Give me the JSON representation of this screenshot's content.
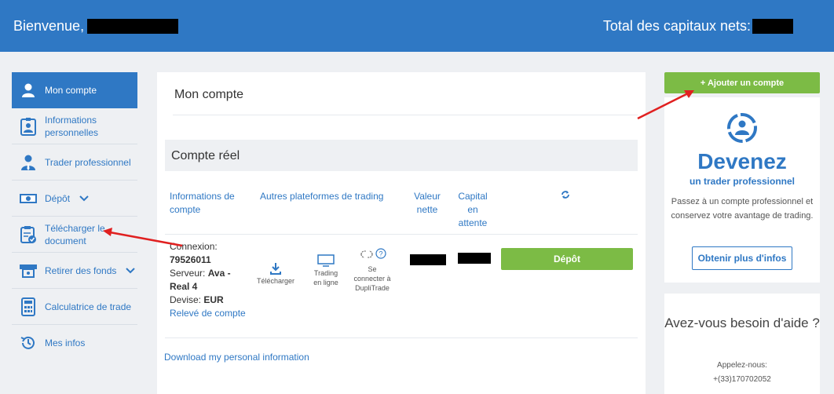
{
  "header": {
    "welcome": "Bienvenue,",
    "total_label": "Total des capitaux nets:"
  },
  "sidebar": {
    "items": [
      {
        "label": "Mon compte",
        "icon": "user-icon",
        "active": true
      },
      {
        "label": "Informations personnelles",
        "icon": "id-card-icon"
      },
      {
        "label": "Trader professionnel",
        "icon": "trader-icon"
      },
      {
        "label": "Dépôt",
        "icon": "cash-icon",
        "chevron": true
      },
      {
        "label": "Télécharger le document",
        "icon": "clipboard-check-icon"
      },
      {
        "label": "Retirer des fonds",
        "icon": "withdraw-icon",
        "chevron": true
      },
      {
        "label": "Calculatrice de trade",
        "icon": "calculator-icon"
      },
      {
        "label": "Mes infos",
        "icon": "history-icon"
      }
    ]
  },
  "main": {
    "title": "Mon compte",
    "section_title": "Compte réel",
    "columns": {
      "account_info": "Informations de compte",
      "platforms": "Autres plateformes de trading",
      "net_value": "Valeur nette",
      "pending_capital": "Capital en attente"
    },
    "account": {
      "login_label": "Connexion:",
      "login_value": "79526011",
      "server_label": "Serveur:",
      "server_value": "Ava - Real 4",
      "currency_label": "Devise:",
      "currency_value": "EUR",
      "statement_link": "Relevé de compte"
    },
    "tools": {
      "download": "Télécharger",
      "web_trading": "Trading en ligne",
      "duplitrade": "Se connecter à DupliTrade"
    },
    "deposit_button": "Dépôt",
    "download_info_link": "Download my personal information"
  },
  "right": {
    "add_account_button": "+ Ajouter un compte",
    "promo_title": "Devenez",
    "promo_subtitle": "un trader professionnel",
    "promo_text": "Passez à un compte professionnel et conservez votre avantage de trading.",
    "promo_button": "Obtenir plus d'infos",
    "help_title": "Avez-vous besoin d'aide ?",
    "help_call": "Appelez-nous:",
    "help_phone": "+(33)170702052"
  },
  "colors": {
    "primary_blue": "#2f78c4",
    "green": "#7cbb45",
    "annotation_red": "#e02020"
  }
}
